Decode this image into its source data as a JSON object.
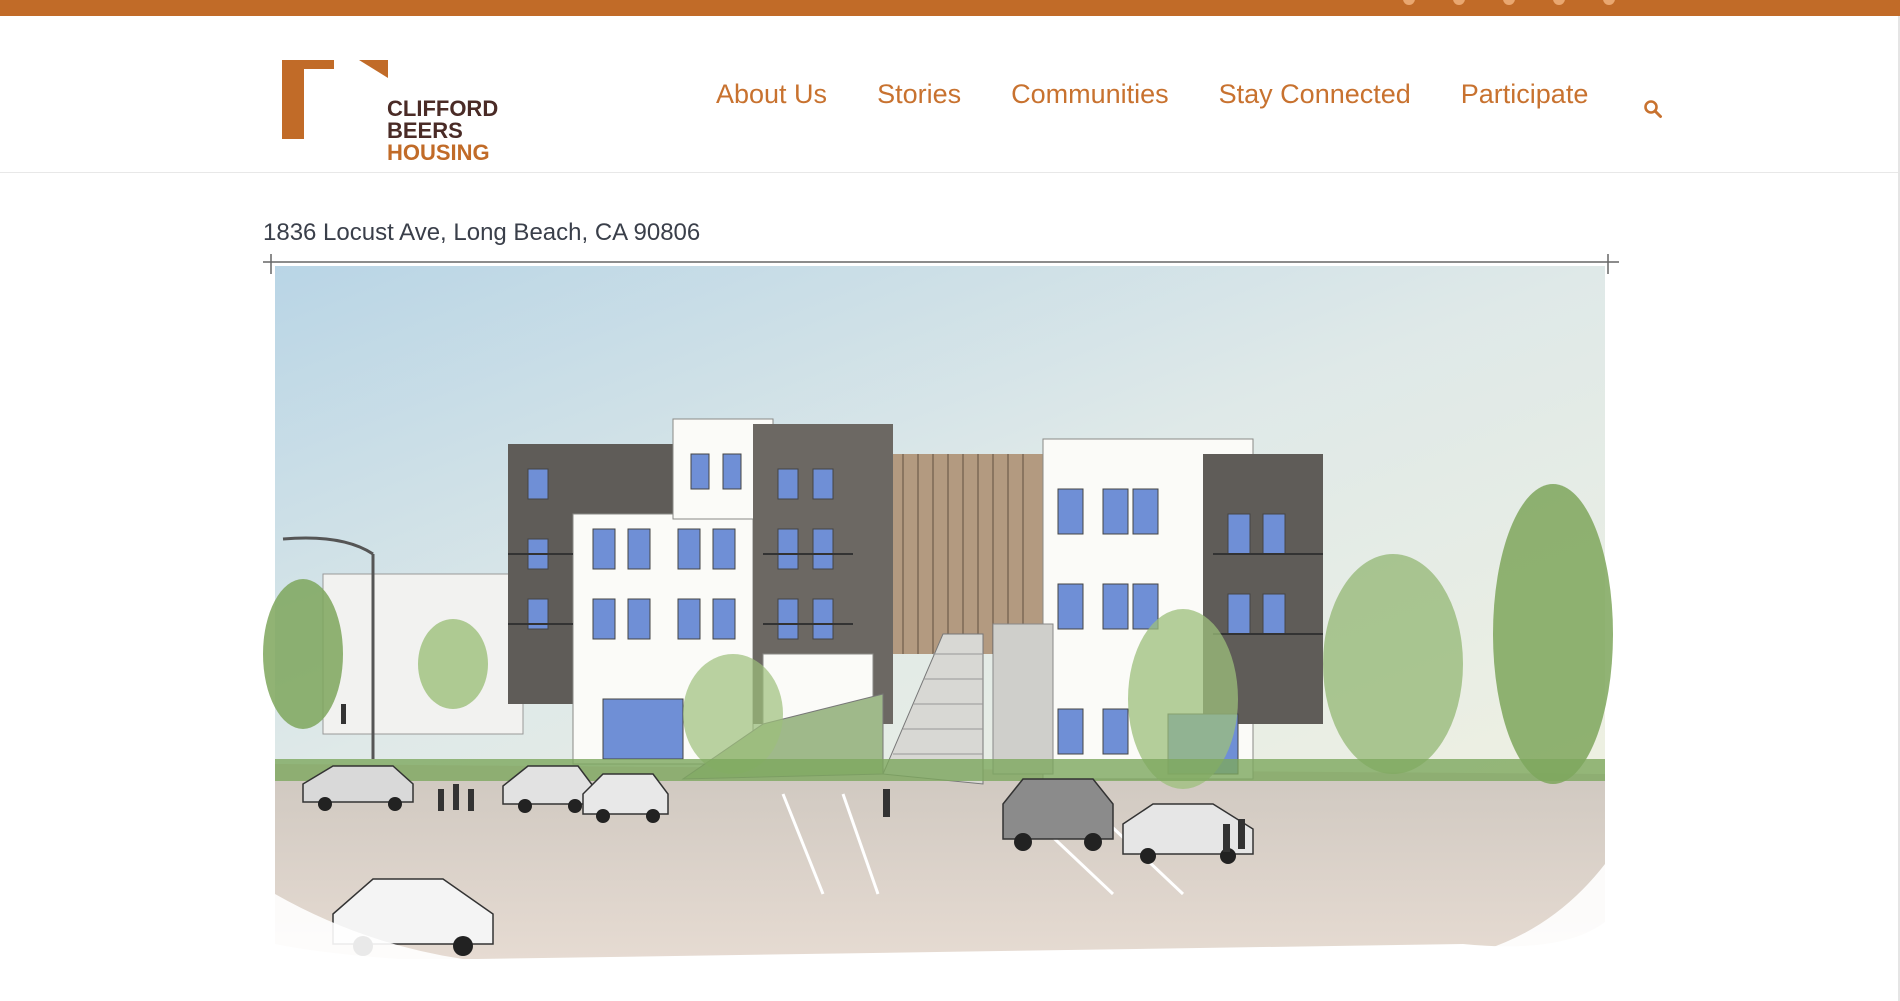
{
  "brand": {
    "name_line1": "CLIFFORD",
    "name_line2": "BEERS",
    "name_line3": "HOUSING",
    "color_primary": "#c16b28",
    "color_dark": "#4a2b26"
  },
  "nav": {
    "items": [
      {
        "label": "About Us"
      },
      {
        "label": "Stories"
      },
      {
        "label": "Communities"
      },
      {
        "label": "Stay Connected"
      },
      {
        "label": "Participate"
      }
    ],
    "search_icon": "search-icon"
  },
  "content": {
    "address": "1836 Locust Ave, Long Beach, CA 90806",
    "image_icon": "architectural-rendering"
  }
}
